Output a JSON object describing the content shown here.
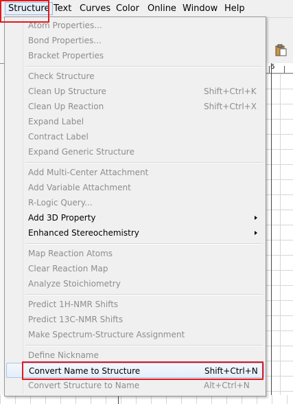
{
  "menubar": {
    "items": [
      "Structure",
      "Text",
      "Curves",
      "Color",
      "Online",
      "Window",
      "Help"
    ]
  },
  "ruler": {
    "label": "6"
  },
  "structure_menu": {
    "items": [
      {
        "label": "Atom Properties...",
        "shortcut": "",
        "enabled": false
      },
      {
        "label": "Bond Properties...",
        "shortcut": "",
        "enabled": false
      },
      {
        "label": "Bracket Properties",
        "shortcut": "",
        "enabled": false
      },
      {
        "label": "Check Structure",
        "shortcut": "",
        "enabled": false
      },
      {
        "label": "Clean Up Structure",
        "shortcut": "Shift+Ctrl+K",
        "enabled": false
      },
      {
        "label": "Clean Up Reaction",
        "shortcut": "Shift+Ctrl+X",
        "enabled": false
      },
      {
        "label": "Expand Label",
        "shortcut": "",
        "enabled": false
      },
      {
        "label": "Contract Label",
        "shortcut": "",
        "enabled": false
      },
      {
        "label": "Expand Generic Structure",
        "shortcut": "",
        "enabled": false
      },
      {
        "label": "Add Multi-Center Attachment",
        "shortcut": "",
        "enabled": false
      },
      {
        "label": "Add Variable Attachment",
        "shortcut": "",
        "enabled": false
      },
      {
        "label": "R-Logic Query...",
        "shortcut": "",
        "enabled": false
      },
      {
        "label": "Add 3D Property",
        "shortcut": "",
        "enabled": true,
        "submenu": true
      },
      {
        "label": "Enhanced Stereochemistry",
        "shortcut": "",
        "enabled": true,
        "submenu": true
      },
      {
        "label": "Map Reaction Atoms",
        "shortcut": "",
        "enabled": false
      },
      {
        "label": "Clear Reaction Map",
        "shortcut": "",
        "enabled": false
      },
      {
        "label": "Analyze Stoichiometry",
        "shortcut": "",
        "enabled": false
      },
      {
        "label": "Predict 1H-NMR Shifts",
        "shortcut": "",
        "enabled": false
      },
      {
        "label": "Predict 13C-NMR Shifts",
        "shortcut": "",
        "enabled": false
      },
      {
        "label": "Make Spectrum-Structure Assignment",
        "shortcut": "",
        "enabled": false
      },
      {
        "label": "Define Nickname",
        "shortcut": "",
        "enabled": false
      },
      {
        "label": "Convert Name to Structure",
        "shortcut": "Shift+Ctrl+N",
        "enabled": true,
        "highlighted": true
      },
      {
        "label": "Convert Structure to Name",
        "shortcut": "Alt+Ctrl+N",
        "enabled": false
      }
    ]
  },
  "colors": {
    "annotation": "#e0191e",
    "disabled_text": "#8d8d8d",
    "menu_bg": "#f0f0f0"
  }
}
